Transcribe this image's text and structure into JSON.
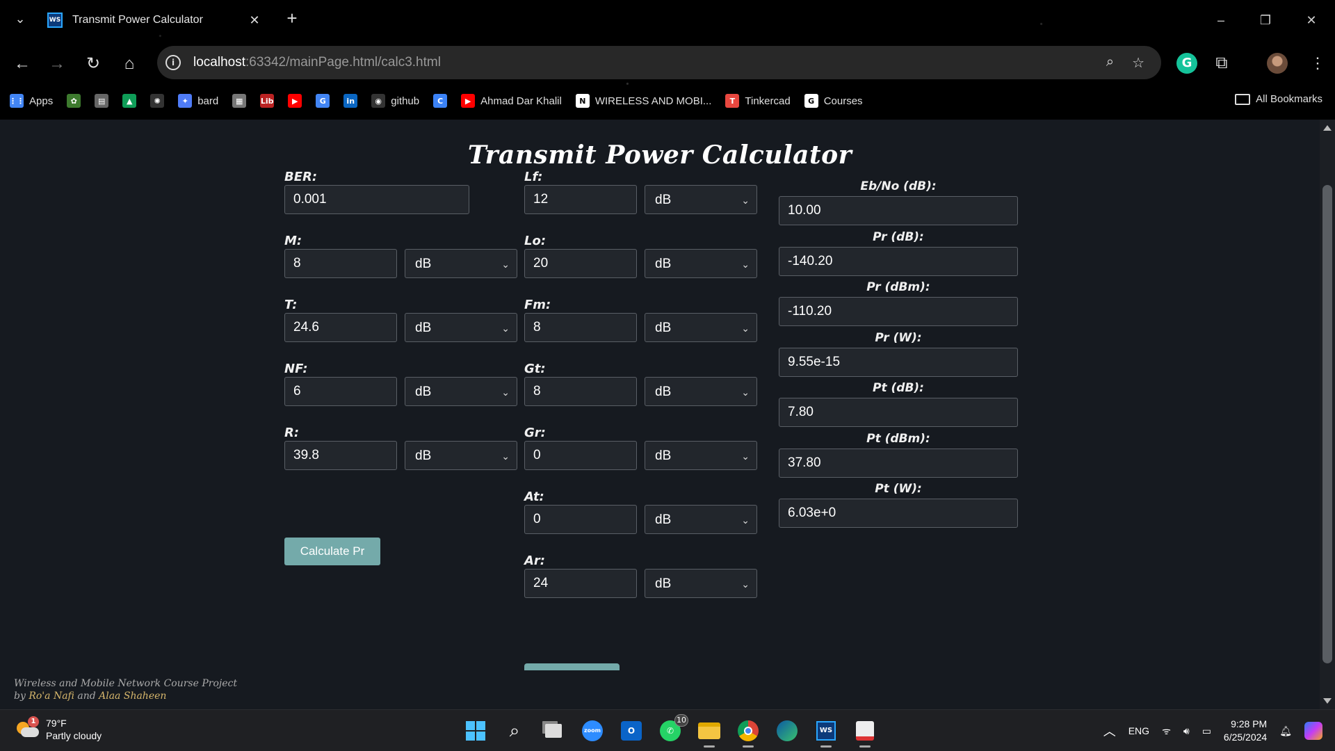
{
  "browser": {
    "tab_title": "Transmit Power Calculator",
    "tab_icon_text": "WS",
    "url_host": "localhost",
    "url_rest": ":63342/mainPage.html/calc3.html",
    "bookmarks": [
      {
        "name": "apps",
        "label": "Apps",
        "color": "#4285f4",
        "glyph": "⋮⋮"
      },
      {
        "name": "leaf",
        "label": "",
        "color": "#3d7a2e",
        "glyph": "✿"
      },
      {
        "name": "doc",
        "label": "",
        "color": "#666",
        "glyph": "▤"
      },
      {
        "name": "drive",
        "label": "",
        "color": "#0f9d58",
        "glyph": "▲"
      },
      {
        "name": "openai",
        "label": "",
        "color": "#333",
        "glyph": "✺"
      },
      {
        "name": "bard",
        "label": "bard",
        "color": "#4f7cf7",
        "glyph": "✦"
      },
      {
        "name": "qr",
        "label": "",
        "color": "#777",
        "glyph": "▦"
      },
      {
        "name": "lib",
        "label": "",
        "color": "#b22",
        "glyph": "Lib"
      },
      {
        "name": "youtube",
        "label": "",
        "color": "#f00",
        "glyph": "▶"
      },
      {
        "name": "translate",
        "label": "",
        "color": "#4285f4",
        "glyph": "G"
      },
      {
        "name": "linkedin",
        "label": "",
        "color": "#0a66c2",
        "glyph": "in"
      },
      {
        "name": "github",
        "label": "github",
        "color": "#333",
        "glyph": "◉"
      },
      {
        "name": "c-app",
        "label": "",
        "color": "#3b82f6",
        "glyph": "C"
      },
      {
        "name": "youtube-ahmad",
        "label": "Ahmad Dar Khalil",
        "color": "#f00",
        "glyph": "▶"
      },
      {
        "name": "notion",
        "label": "WIRELESS AND MOBI...",
        "color": "#fff",
        "glyph": "N"
      },
      {
        "name": "tinkercad",
        "label": "Tinkercad",
        "color": "#e8473f",
        "glyph": "T"
      },
      {
        "name": "courses",
        "label": "Courses",
        "color": "#fff",
        "glyph": "G"
      }
    ],
    "all_bookmarks": "All Bookmarks"
  },
  "page": {
    "title": "Transmit Power Calculator",
    "inputs_col1": [
      {
        "label": "BER:",
        "value": "0.001"
      },
      {
        "label": "M:",
        "value": "8",
        "unit": "dB"
      },
      {
        "label": "T:",
        "value": "24.6",
        "unit": "dB"
      },
      {
        "label": "NF:",
        "value": "6",
        "unit": "dB"
      },
      {
        "label": "R:",
        "value": "39.8",
        "unit": "dB"
      }
    ],
    "inputs_col2": [
      {
        "label": "Lf:",
        "value": "12",
        "unit": "dB"
      },
      {
        "label": "Lo:",
        "value": "20",
        "unit": "dB"
      },
      {
        "label": "Fm:",
        "value": "8",
        "unit": "dB"
      },
      {
        "label": "Gt:",
        "value": "8",
        "unit": "dB"
      },
      {
        "label": "Gr:",
        "value": "0",
        "unit": "dB"
      },
      {
        "label": "At:",
        "value": "0",
        "unit": "dB"
      },
      {
        "label": "Ar:",
        "value": "24",
        "unit": "dB"
      }
    ],
    "results": [
      {
        "label": "Eb/No (dB):",
        "value": "10.00"
      },
      {
        "label": "Pr (dB):",
        "value": "-140.20"
      },
      {
        "label": "Pr (dBm):",
        "value": "-110.20"
      },
      {
        "label": "Pr (W):",
        "value": "9.55e-15"
      },
      {
        "label": "Pt (dB):",
        "value": "7.80"
      },
      {
        "label": "Pt (dBm):",
        "value": "37.80"
      },
      {
        "label": "Pt (W):",
        "value": "6.03e+0"
      }
    ],
    "calc_button": "Calculate Pr",
    "footer_line1": "Wireless and Mobile Network Course Project",
    "footer_by": "by",
    "footer_name1": "Ro'a Nafi",
    "footer_and": "and",
    "footer_name2": "Alaa Shaheen"
  },
  "taskbar": {
    "weather_temp": "79°F",
    "weather_desc": "Partly cloudy",
    "weather_badge": "1",
    "whatsapp_badge": "10",
    "lang": "ENG",
    "time": "9:28 PM",
    "date": "6/25/2024"
  }
}
